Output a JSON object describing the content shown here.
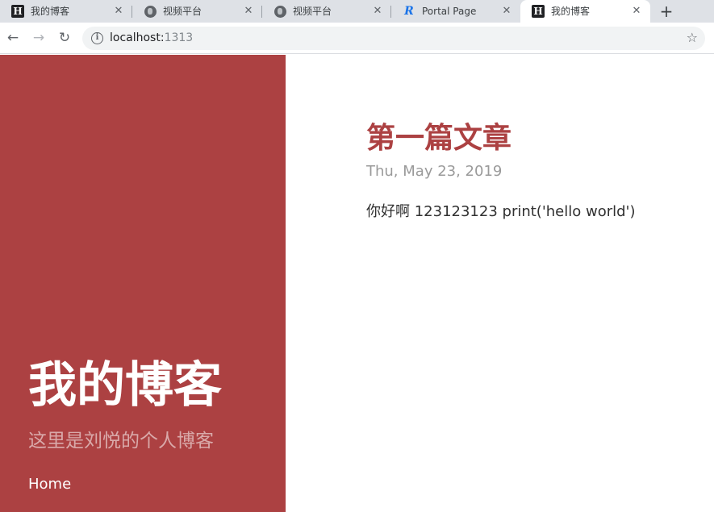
{
  "browser": {
    "tabs": [
      {
        "title": "我的博客",
        "favicon": "hugo-h-icon",
        "active": false
      },
      {
        "title": "视频平台",
        "favicon": "globe-icon",
        "active": false
      },
      {
        "title": "视频平台",
        "favicon": "globe-icon",
        "active": false
      },
      {
        "title": "Portal Page",
        "favicon": "portal-r-icon",
        "active": false
      },
      {
        "title": "我的博客",
        "favicon": "hugo-h-icon",
        "active": true
      }
    ],
    "url_host": "localhost:",
    "url_port": "1313",
    "icons": {
      "back": "←",
      "forward": "→",
      "reload": "↻",
      "close": "✕",
      "new_tab": "+",
      "info": "i",
      "star": "☆"
    }
  },
  "sidebar": {
    "site_title": "我的博客",
    "site_description": "这里是刘悦的个人博客",
    "nav_home": "Home",
    "background_color": "#ac4142"
  },
  "post": {
    "title": "第一篇文章",
    "date": "Thu, May 23, 2019",
    "body": "你好啊 123123123 print('hello world')",
    "title_color": "#ac4142"
  }
}
